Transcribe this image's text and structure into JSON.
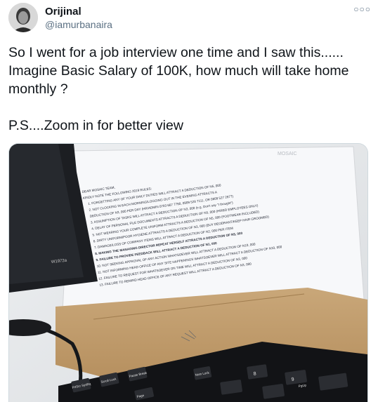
{
  "author": {
    "display_name": "Orijinal",
    "handle": "@iamurbanaira"
  },
  "more_icon": "more-horizontal-icon",
  "tweet": {
    "lines": [
      "So I went for a job interview one time and I saw this......",
      "Imagine Basic Salary of 100K,  how much will take home",
      "monthly ?",
      "P.S....Zoom in for better view"
    ]
  },
  "photo": {
    "monitor_model": "W1972a",
    "paper_brand": "MOSAIC",
    "memo_lines": [
      "DEAR MOSAIC TEAM,",
      "KINDLY NOTE THE FOLLOWING 2019 RULES:",
      "1. FORGETTING ANY OF YOUR DAILY DUTIES WILL ATTRACT A DEDUCTION OF N5, 000",
      "2. NOT CLOCKING IN EACH MORNING/LOGGING OUT IN THE EVENING ATTRACTS A",
      "DEDUCTION OF N3, 000 PER DAY (HR/ADMIN 0703 667 7790, 0909 528 7111, OR 0809 527 2877)",
      "3. ASSUMPTION OF TASKS WILL ATTRACT A DEDUCTION OF N3, 000 (e.g. Don't say \"I thought\")",
      "4. DELAY OF PERSONAL FILE DOCUMENTS ATTRACTS A DEDUCTION OF N5, 000 (HIRED EMPLOYEES ONLY)",
      "5. NOT WEARING YOUR COMPLETE UNIFORM ATTRACTS A DEDUCTION OF N5, 000 (FOOTWEAR INCLUDED)",
      "6. DIRTY UNIFORM/POOR HYGIENE ATTRACTS A DEDUCTION OF N3, 000 (BUY DEODRANT/KEEP HAIR GROOMED)",
      "7. DAMAGE/LOSS OF COMPANY ITEMS WILL ATTRACT A DEDUCTION OF N2, 000 PER ITEM",
      "8. MAKING THE MANAGING DIRECTOR REPEAT HERSELF ATTRACTS A DEDUCTION OF N5, 000",
      "9. FAILURE TO PROVIDE FEEDBACK WILL ATTRACT A DEDUCTION OF N1, 000",
      "10. NOT SEEKING APPROVAL OF ANY ACTION WHATSOEVER WILL ATTRACT A DEDUCTION OF N10, 000",
      "11. NOT INFORMING HEAD OFFICE OF ANY SITE HAPPENINGS WHATSOEVER WILL ATTRACT A DEDUCTION OF N10, 000",
      "12. FAILURE TO REQUEST FOR WHATSOEVER ON TIME WILL ATTRACT A DEDUCTION OF N3, 000",
      "13. FAILURE TO REMIND HEAD OFFICE OF ANY REQUEST WILL ATTRACT A DEDUCTION OF N3, 000"
    ],
    "keyboard_keys": [
      "PrtScr SysRq",
      "Scroll Lock",
      "Pause Break",
      "Num Lock",
      "Page",
      "8",
      "9",
      "PgUp"
    ]
  }
}
